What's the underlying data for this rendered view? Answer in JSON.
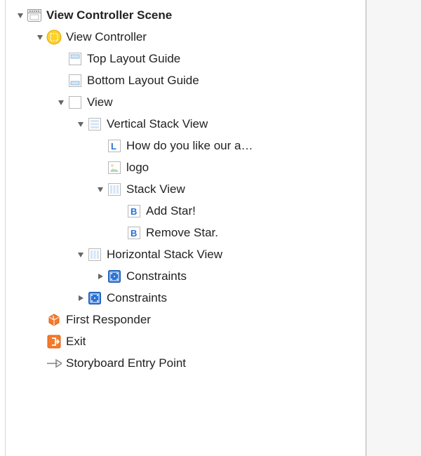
{
  "outline": {
    "scene": "View Controller Scene",
    "vc": "View Controller",
    "topGuide": "Top Layout Guide",
    "bottomGuide": "Bottom Layout Guide",
    "view": "View",
    "vStack": "Vertical Stack View",
    "label1": "How do you like our a…",
    "image1": "logo",
    "innerStack": "Stack View",
    "btnAdd": "Add Star!",
    "btnRemove": "Remove Star.",
    "hStack": "Horizontal Stack View",
    "constraints1": "Constraints",
    "constraints2": "Constraints",
    "firstResponder": "First Responder",
    "exit": "Exit",
    "entryPoint": "Storyboard Entry Point"
  }
}
